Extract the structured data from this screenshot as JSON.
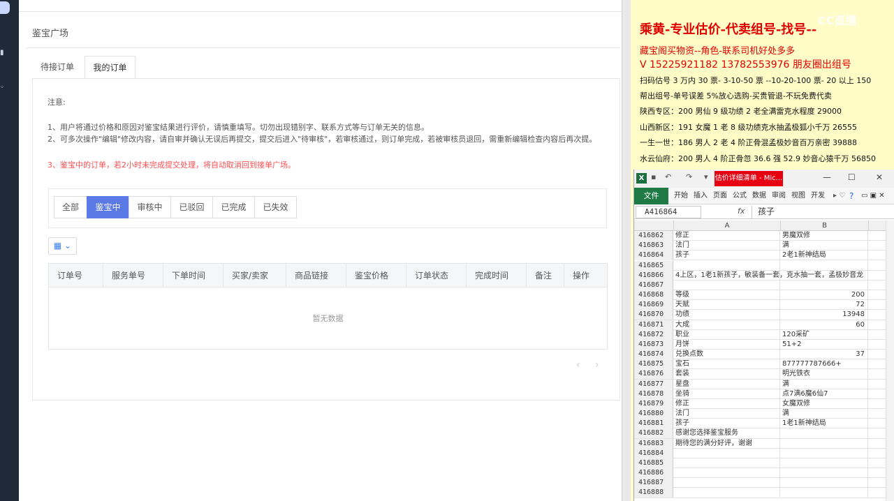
{
  "main": {
    "page_title": "鉴宝广场",
    "tabs": [
      {
        "label": "待接订单"
      },
      {
        "label": "我的订单"
      }
    ],
    "notice": {
      "title": "注意:",
      "lines": [
        "1、用户将通过价格和原因对鉴宝结果进行评价，请慎重填写。切勿出现错别字、联系方式等与订单无关的信息。",
        "2、可多次操作\"编辑\"修改内容，请自审并确认无误后再提交，提交后进入\"待审核\"，若审核通过，则订单完成，若被审核员退回，需重新编辑检查内容后再次提。",
        "3、鉴宝中的订单，若2小时未完成提交处理，将自动取消回到接单广场。"
      ]
    },
    "filters": [
      {
        "label": "全部"
      },
      {
        "label": "鉴宝中"
      },
      {
        "label": "审核中"
      },
      {
        "label": "已驳回"
      },
      {
        "label": "已完成"
      },
      {
        "label": "已失效"
      }
    ],
    "table": {
      "headers": [
        "订单号",
        "服务单号",
        "下单时间",
        "买家/卖家",
        "商品链接",
        "鉴宝价格",
        "订单状态",
        "完成时间",
        "备注",
        "操作"
      ],
      "empty_text": "暂无数据"
    }
  },
  "notepad": {
    "watermark": "CC直播",
    "lines": [
      "乘黄-专业估价-代卖组号-找号--",
      "藏宝阁买物资--角色-联系司机好处多多",
      "V 15225921182   13782553976 朋友圈出组号",
      "扫码估号 3 万内 30 票- 3-10-50 票  --10-20-100 票- 20 以上 150",
      "帮出组号-单号误差 5%放心选购-买贵管退-不玩免费代卖",
      "陕西专区：200 男仙 9 级功绩 2 老全满雷克水程度 29000",
      "山西新区：191 女魔 1 老 8 级功绩克水抽孟极狐小千万 26555",
      "一生一世：186 男人 2 老 4 阶正骨混孟极妙音百万亲密 39888",
      "水云仙府：200 男人 4 阶正骨忽 36.6 强 52.9 妙音心猿千万 56850"
    ]
  },
  "excel": {
    "window_title": "估价详细清单 - Mic...",
    "ribbon_tabs": [
      "文件",
      "开始",
      "插入",
      "页面",
      "公式",
      "数据",
      "审阅",
      "视图",
      "开发"
    ],
    "name_box": "A416864",
    "formula": "孩子",
    "columns": [
      "A",
      "B"
    ],
    "rows": [
      {
        "n": "416862",
        "a": "修正",
        "b": "男魔双修",
        "num": false
      },
      {
        "n": "416863",
        "a": "法门",
        "b": "满",
        "num": false
      },
      {
        "n": "416864",
        "a": "孩子",
        "b": "2老1新神结局",
        "num": false
      },
      {
        "n": "416865",
        "a": "",
        "b": "",
        "num": false
      },
      {
        "n": "416866",
        "a": "4上区，1老1新孩子，敏装备一套，克水抽一套，孟极妙音龙",
        "b": "",
        "num": false
      },
      {
        "n": "416867",
        "a": "",
        "b": "",
        "num": false
      },
      {
        "n": "416868",
        "a": "等级",
        "b": "200",
        "num": true
      },
      {
        "n": "416869",
        "a": "天赋",
        "b": "72",
        "num": true
      },
      {
        "n": "416870",
        "a": "功绩",
        "b": "13948",
        "num": true
      },
      {
        "n": "416871",
        "a": "大成",
        "b": "60",
        "num": true
      },
      {
        "n": "416872",
        "a": "职业",
        "b": "120采矿",
        "num": false
      },
      {
        "n": "416873",
        "a": "月饼",
        "b": "51+2",
        "num": false
      },
      {
        "n": "416874",
        "a": "兑换点数",
        "b": "37",
        "num": true
      },
      {
        "n": "416875",
        "a": "宝石",
        "b": "877777787666+",
        "num": false
      },
      {
        "n": "416876",
        "a": "套装",
        "b": "明光铁衣",
        "num": false
      },
      {
        "n": "416877",
        "a": "星盘",
        "b": "满",
        "num": false
      },
      {
        "n": "416878",
        "a": "坐骑",
        "b": "点7满6魔6仙7",
        "num": false
      },
      {
        "n": "416879",
        "a": "修正",
        "b": "女魔双修",
        "num": false
      },
      {
        "n": "416880",
        "a": "法门",
        "b": "满",
        "num": false
      },
      {
        "n": "416881",
        "a": "孩子",
        "b": "1老1新神结局",
        "num": false
      },
      {
        "n": "416882",
        "a": "感谢您选择鉴宝服务",
        "b": "",
        "num": false
      },
      {
        "n": "416883",
        "a": "期待您的满分好评，谢谢",
        "b": "",
        "num": false
      },
      {
        "n": "416884",
        "a": "",
        "b": "",
        "num": false
      },
      {
        "n": "416885",
        "a": "",
        "b": "",
        "num": false
      },
      {
        "n": "416886",
        "a": "",
        "b": "",
        "num": false
      },
      {
        "n": "416887",
        "a": "",
        "b": "",
        "num": false
      },
      {
        "n": "416888",
        "a": "",
        "b": "",
        "num": false
      }
    ]
  }
}
